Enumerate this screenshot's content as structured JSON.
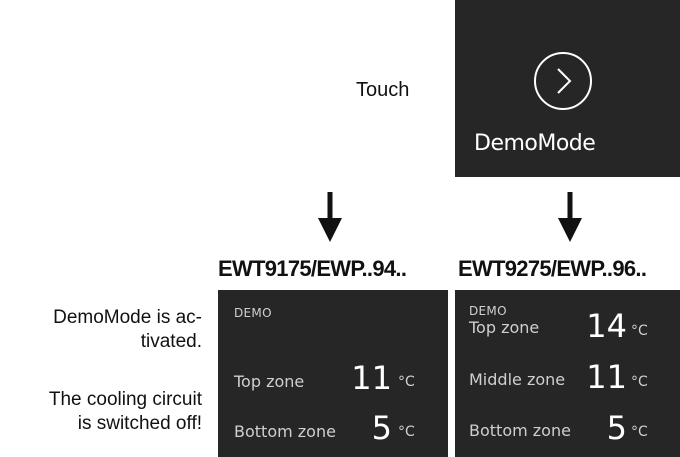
{
  "touch_prompt": "Touch",
  "demo_button": {
    "label": "DemoMode",
    "icon": "chevron-right-circle-icon"
  },
  "models": [
    {
      "name": "EWT9175/EWP..94..",
      "demo_tag": "DEMO",
      "zones": [
        {
          "label": "Top zone",
          "value": "11",
          "unit": "°C"
        },
        {
          "label": "Bottom zone",
          "value": "5",
          "unit": "°C"
        }
      ]
    },
    {
      "name": "EWT9275/EWP..96..",
      "demo_tag": "DEMO",
      "zones": [
        {
          "label": "Top zone",
          "value": "14",
          "unit": "°C"
        },
        {
          "label": "Middle zone",
          "value": "11",
          "unit": "°C"
        },
        {
          "label": "Bottom zone",
          "value": "5",
          "unit": "°C"
        }
      ]
    }
  ],
  "notes": {
    "activated_line1": "DemoMode is ac-",
    "activated_line2": "tivated.",
    "cooling_line1": "The cooling circuit",
    "cooling_line2": "is switched off!"
  },
  "colors": {
    "panel_bg": "#262626",
    "panel_text": "#ffffff"
  }
}
